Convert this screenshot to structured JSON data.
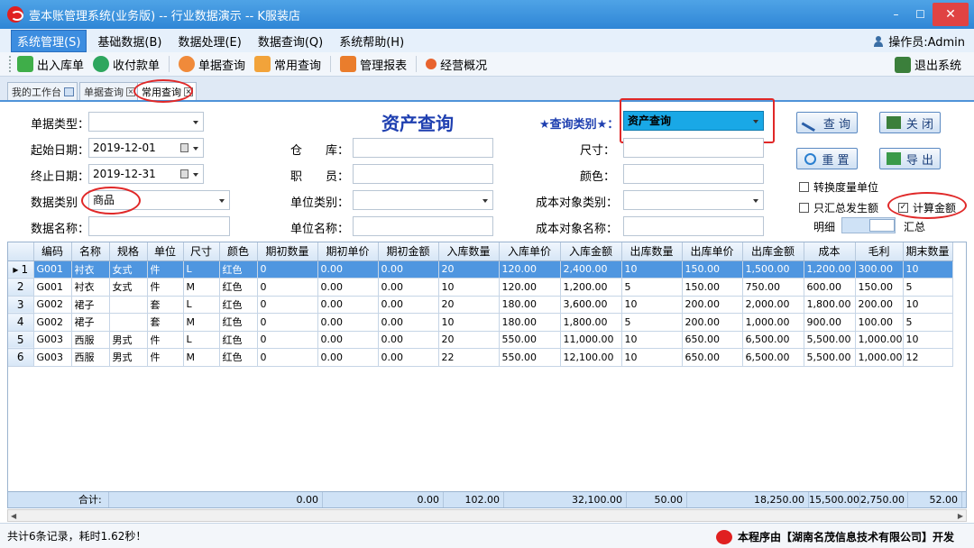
{
  "window": {
    "title": "壹本账管理系统(业务版) -- 行业数据演示 -- K服装店",
    "controls": [
      "–",
      "☐",
      "✕"
    ]
  },
  "menu": {
    "items": [
      "系统管理(S)",
      "基础数据(B)",
      "数据处理(E)",
      "数据查询(Q)",
      "系统帮助(H)"
    ],
    "operator": "操作员:Admin"
  },
  "toolbar": {
    "items": [
      "出入库单",
      "收付款单",
      "单据查询",
      "常用查询",
      "管理报表",
      "经营概况"
    ],
    "exit": "退出系统"
  },
  "tabs": [
    "我的工作台",
    "单据查询",
    "常用查询"
  ],
  "form": {
    "title": "资产查询",
    "bill_type_label": "单据类型：",
    "bill_type_value": "",
    "start_date_label": "起始日期：",
    "start_date": "2019-12-01",
    "end_date_label": "终止日期：",
    "end_date": "2019-12-31",
    "data_category_label": "数据类别",
    "data_category": "商品",
    "data_name_label": "数据名称：",
    "data_name": "",
    "warehouse_label": "仓　　库：",
    "staff_label": "职　　员：",
    "unit_category_label": "单位类别：",
    "unit_name_label": "单位名称：",
    "query_type_label": "★查询类别★：",
    "query_type": "资产查询",
    "size_label": "尺寸：",
    "color_label": "颜色：",
    "cost_object_type_label": "成本对象类别：",
    "cost_object_name_label": "成本对象名称：",
    "buttons": {
      "query": "查 询",
      "close": "关 闭",
      "reset": "重 置",
      "export": "导 出"
    },
    "checks": {
      "convert_unit": "转换度量单位",
      "only_summary": "只汇总发生额",
      "calc_amount": "计算金额",
      "calc_amount_checked": "✓"
    },
    "toggle": {
      "left": "明细",
      "right": "汇总"
    }
  },
  "table": {
    "headers": [
      "编码",
      "名称",
      "规格",
      "单位",
      "尺寸",
      "颜色",
      "期初数量",
      "期初单价",
      "期初金额",
      "入库数量",
      "入库单价",
      "入库金额",
      "出库数量",
      "出库单价",
      "出库金额",
      "成本",
      "毛利",
      "期末数量"
    ],
    "rows": [
      [
        "G001",
        "衬衣",
        "女式",
        "件",
        "L",
        "红色",
        "0",
        "0.00",
        "0.00",
        "20",
        "120.00",
        "2,400.00",
        "10",
        "150.00",
        "1,500.00",
        "1,200.00",
        "300.00",
        "10"
      ],
      [
        "G001",
        "衬衣",
        "女式",
        "件",
        "M",
        "红色",
        "0",
        "0.00",
        "0.00",
        "10",
        "120.00",
        "1,200.00",
        "5",
        "150.00",
        "750.00",
        "600.00",
        "150.00",
        "5"
      ],
      [
        "G002",
        "裙子",
        "",
        "套",
        "L",
        "红色",
        "0",
        "0.00",
        "0.00",
        "20",
        "180.00",
        "3,600.00",
        "10",
        "200.00",
        "2,000.00",
        "1,800.00",
        "200.00",
        "10"
      ],
      [
        "G002",
        "裙子",
        "",
        "套",
        "M",
        "红色",
        "0",
        "0.00",
        "0.00",
        "10",
        "180.00",
        "1,800.00",
        "5",
        "200.00",
        "1,000.00",
        "900.00",
        "100.00",
        "5"
      ],
      [
        "G003",
        "西服",
        "男式",
        "件",
        "L",
        "红色",
        "0",
        "0.00",
        "0.00",
        "20",
        "550.00",
        "11,000.00",
        "10",
        "650.00",
        "6,500.00",
        "5,500.00",
        "1,000.00",
        "10"
      ],
      [
        "G003",
        "西服",
        "男式",
        "件",
        "M",
        "红色",
        "0",
        "0.00",
        "0.00",
        "22",
        "550.00",
        "12,100.00",
        "10",
        "650.00",
        "6,500.00",
        "5,500.00",
        "1,000.00",
        "12"
      ]
    ],
    "row_numbers": [
      "1",
      "2",
      "3",
      "4",
      "5",
      "6"
    ],
    "selected_marker": "▸",
    "totals": {
      "label": "合计:",
      "opening_qty": "0.00",
      "opening_amount": "0.00",
      "in_qty": "102.00",
      "in_amount": "32,100.00",
      "out_qty": "50.00",
      "out_amount": "18,250.00",
      "cost": "15,500.00",
      "gross_profit": "2,750.00",
      "closing_qty": "52.00"
    }
  },
  "status": {
    "text": "共计6条记录，耗时1.62秒！",
    "credit": "本程序由【湖南名茂信息技术有限公司】开发"
  }
}
